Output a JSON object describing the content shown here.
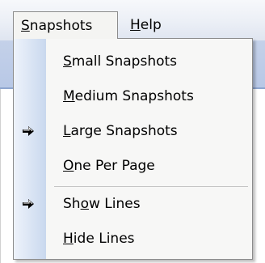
{
  "menubar": {
    "menus": [
      {
        "label": "Snapshots",
        "mnemonic_index": 0,
        "open": true
      },
      {
        "label": "Help",
        "mnemonic_index": 0,
        "open": false
      }
    ]
  },
  "dropdown": {
    "items": [
      {
        "label": "Small Snapshots",
        "mnemonic_index": 0,
        "checked": false
      },
      {
        "label": "Medium Snapshots",
        "mnemonic_index": 0,
        "checked": false
      },
      {
        "label": "Large Snapshots",
        "mnemonic_index": 0,
        "checked": true
      },
      {
        "label": "One Per Page",
        "mnemonic_index": 0,
        "checked": false
      },
      {
        "label": "Show Lines",
        "mnemonic_index": 2,
        "checked": true
      },
      {
        "label": "Hide Lines",
        "mnemonic_index": 0,
        "checked": false
      }
    ],
    "icons": {
      "checked": "radio-bullet-arrow-icon"
    }
  },
  "colors": {
    "gutter_start": "#eef3fb",
    "gutter_end": "#c9d8ee",
    "menu_bg": "#f7f7f6",
    "menubar_band": "#b8c8e6"
  }
}
